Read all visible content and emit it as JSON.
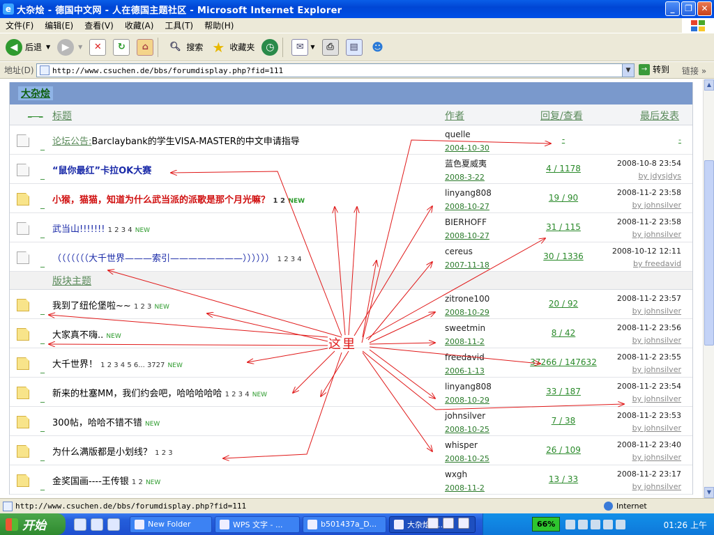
{
  "window": {
    "title": "大杂烩 - 德国中文网 - 人在德国主题社区 - Microsoft Internet Explorer"
  },
  "menu": [
    "文件(F)",
    "编辑(E)",
    "查看(V)",
    "收藏(A)",
    "工具(T)",
    "帮助(H)"
  ],
  "toolbar": {
    "back": "后退",
    "search": "搜索",
    "favorites": "收藏夹"
  },
  "address": {
    "label": "地址(D)",
    "url": "http://www.csuchen.de/bbs/forumdisplay.php?fid=111",
    "go": "转到",
    "links": "链接"
  },
  "forum": {
    "name": "大杂烩",
    "columns": {
      "title": "标题",
      "author": "作者",
      "replies_views": "回复/查看",
      "last_post": "最后发表"
    },
    "section_label": "版块主题",
    "annotation": "这里",
    "announcement": {
      "prefix": "论坛公告:",
      "title": "Barclaybank的学生VISA-MASTER的中文申请指导",
      "author": "quelle",
      "date": "2004-10-30",
      "rv": "-",
      "last": "-"
    },
    "pinned": [
      {
        "title": "“鼠你最红”卡拉OK大赛",
        "style": "blue",
        "pages": "",
        "author": "蓝色夏威夷",
        "date": "2008-3-22",
        "rv": "4 / 1178",
        "last_time": "2008-10-8 23:54",
        "last_by": "by jdysjdys"
      },
      {
        "title": "小猴，猫猫，知道为什么武当派的派歌是那个月光嘛？",
        "style": "red",
        "pages": "1 2",
        "isnew": "NEW",
        "author": "linyang808",
        "date": "2008-10-27",
        "rv": "19 / 90",
        "last_time": "2008-11-2 23:58",
        "last_by": "by johnsilver"
      },
      {
        "title": "武当山!!!!!!!",
        "style": "nav",
        "pages": "1 2 3 4",
        "isnew": "NEW",
        "author": "BIERHOFF",
        "date": "2008-10-27",
        "rv": "31 / 115",
        "last_time": "2008-11-2 23:58",
        "last_by": "by johnsilver"
      },
      {
        "title": "（（（（（（（大千世界———索引————————））））））",
        "style": "nav",
        "pages": "1 2 3 4",
        "author": "cereus",
        "date": "2007-11-18",
        "rv": "30 / 1336",
        "last_time": "2008-10-12 12:11",
        "last_by": "by freedavid"
      }
    ],
    "threads": [
      {
        "title": "我到了纽伦堡啦~~",
        "pages": "1 2 3",
        "isnew": "NEW",
        "author": "zitrone100",
        "date": "2008-10-29",
        "rv": "20 / 92",
        "last_time": "2008-11-2 23:57",
        "last_by": "by johnsilver"
      },
      {
        "title": "大家真不嗨..",
        "pages": "",
        "isnew": "NEW",
        "author": "sweetmin",
        "date": "2008-11-2",
        "rv": "8 / 42",
        "last_time": "2008-11-2 23:56",
        "last_by": "by johnsilver"
      },
      {
        "title": "大千世界！",
        "pages": "1 2 3 4 5 6... 3727",
        "isnew": "NEW",
        "author": "freedavid",
        "date": "2006-1-13",
        "rv": "37266 / 147632",
        "last_time": "2008-11-2 23:55",
        "last_by": "by johnsilver"
      },
      {
        "title": "新来的杜塞MM，我们约会吧，哈哈哈哈哈",
        "pages": "1 2 3 4",
        "isnew": "NEW",
        "author": "linyang808",
        "date": "2008-10-29",
        "rv": "33 / 187",
        "last_time": "2008-11-2 23:54",
        "last_by": "by johnsilver"
      },
      {
        "title": "300帖，哈哈不错不错",
        "pages": "",
        "isnew": "NEW",
        "author": "johnsilver",
        "date": "2008-10-25",
        "rv": "7 / 38",
        "last_time": "2008-11-2 23:53",
        "last_by": "by johnsilver"
      },
      {
        "title": "为什么满版都是小划线？",
        "pages": "1 2 3",
        "isnew": "",
        "author": "whisper",
        "date": "2008-10-25",
        "rv": "26 / 109",
        "last_time": "2008-11-2 23:40",
        "last_by": "by johnsilver"
      },
      {
        "title": "金奖国画----王传银",
        "pages": "1 2",
        "isnew": "NEW",
        "author": "wxgh",
        "date": "2008-11-2",
        "rv": "13 / 33",
        "last_time": "2008-11-2 23:17",
        "last_by": "by johnsilver"
      }
    ]
  },
  "status": {
    "url": "http://www.csuchen.de/bbs/forumdisplay.php?fid=111",
    "zone": "Internet"
  },
  "taskbar": {
    "start": "开始",
    "tasks": [
      "New Folder",
      "WPS 文字 - ...",
      "b501437a_D...",
      "大杂烩 - ..."
    ],
    "battery": "66%",
    "clock": "01:26 上午"
  }
}
